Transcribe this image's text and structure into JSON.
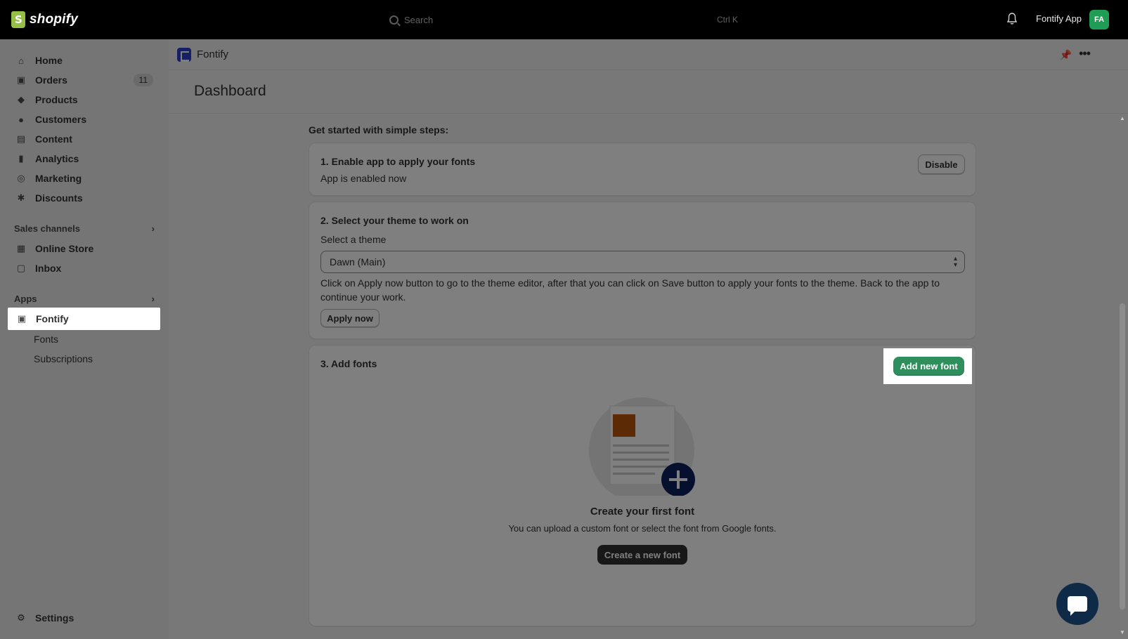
{
  "topbar": {
    "brand": "shopify",
    "search_placeholder": "Search",
    "search_shortcut": "Ctrl K",
    "user_name": "Fontify App",
    "avatar_initials": "FA"
  },
  "sidebar": {
    "items": [
      {
        "label": "Home",
        "icon": "home-icon"
      },
      {
        "label": "Orders",
        "icon": "inbox-icon",
        "badge": "11"
      },
      {
        "label": "Products",
        "icon": "tag-icon"
      },
      {
        "label": "Customers",
        "icon": "person-icon"
      },
      {
        "label": "Content",
        "icon": "image-icon"
      },
      {
        "label": "Analytics",
        "icon": "bar-chart-icon"
      },
      {
        "label": "Marketing",
        "icon": "target-icon"
      },
      {
        "label": "Discounts",
        "icon": "discount-icon"
      }
    ],
    "sales_channels_label": "Sales channels",
    "sales_channels": [
      {
        "label": "Online Store",
        "icon": "store-icon"
      },
      {
        "label": "Inbox",
        "icon": "chat-icon"
      }
    ],
    "apps_label": "Apps",
    "app_item": "Fontify",
    "app_subitems": [
      "Fonts",
      "Subscriptions"
    ],
    "settings_label": "Settings"
  },
  "app_header": {
    "title": "Fontify"
  },
  "page": {
    "title": "Dashboard",
    "section_title": "Get started with simple steps:"
  },
  "step1": {
    "title": "1. Enable app to apply your fonts",
    "status": "App is enabled now",
    "button": "Disable"
  },
  "step2": {
    "title": "2. Select your theme to work on",
    "select_label": "Select a theme",
    "select_value": "Dawn (Main)",
    "help_text": "Click on Apply now button to go to the theme editor, after that you can click on Save button to apply your fonts to the theme. Back to the app to continue your work.",
    "button": "Apply now"
  },
  "step3": {
    "title": "3. Add fonts",
    "button": "Add new font",
    "empty_title": "Create your first font",
    "empty_text": "You can upload a custom font or select the font from Google fonts.",
    "empty_button": "Create a new font"
  },
  "colors": {
    "primary_green": "#2f8f5c",
    "app_logo": "#2c3fc8",
    "avatar": "#1f9d55",
    "chat": "#0e2a47"
  }
}
